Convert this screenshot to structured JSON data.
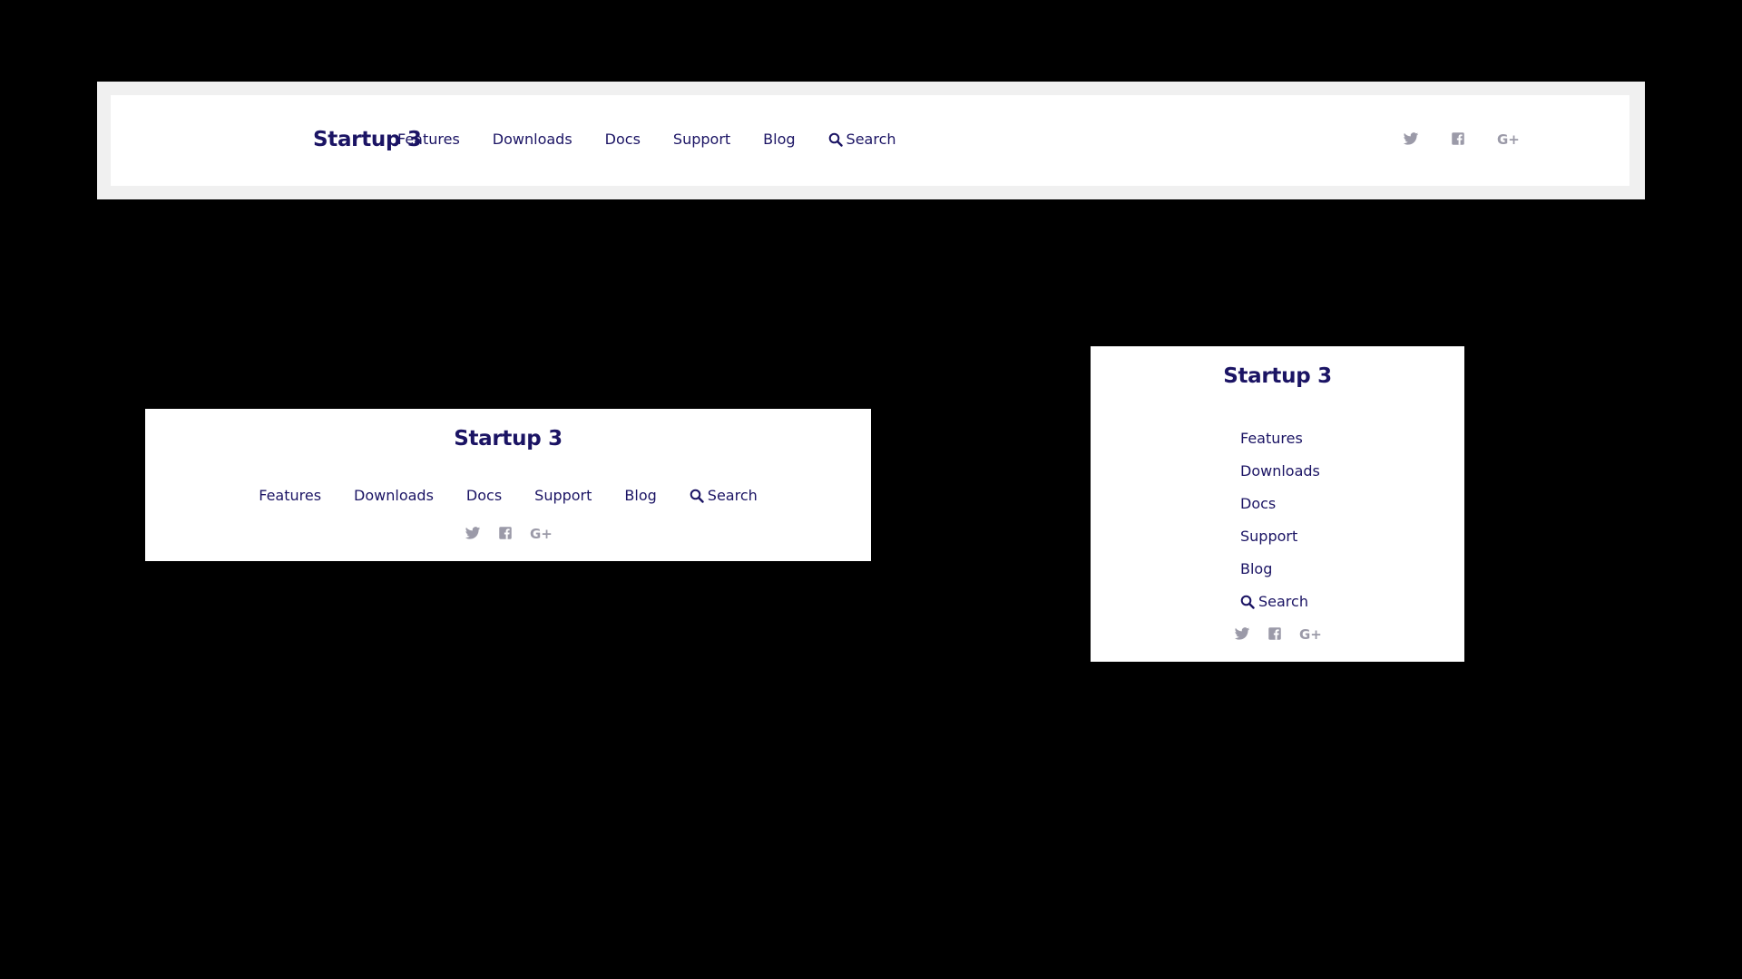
{
  "brand": {
    "title": "Startup 3"
  },
  "nav": {
    "items": [
      {
        "label": "Features"
      },
      {
        "label": "Downloads"
      },
      {
        "label": "Docs"
      },
      {
        "label": "Support"
      },
      {
        "label": "Blog"
      }
    ],
    "search_label": "Search"
  },
  "social": {
    "icons": [
      "twitter-icon",
      "facebook-icon",
      "google-plus-icon"
    ]
  },
  "colors": {
    "page_background": "#000000",
    "header_background": "#ffffff",
    "frame_background": "#f0f0f0",
    "brand_text": "#1b1464",
    "social_icon": "#9b9aa8"
  }
}
